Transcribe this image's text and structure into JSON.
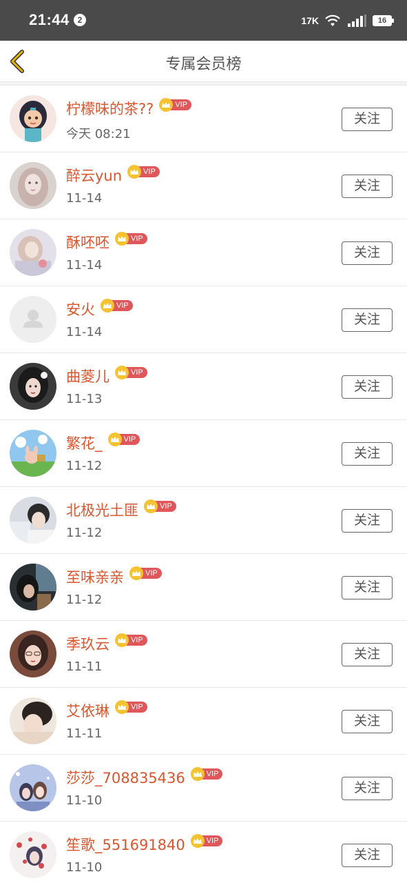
{
  "status_bar": {
    "time": "21:44",
    "notification_count": "2",
    "net_speed": "17K",
    "battery": "16",
    "icons": [
      "wifi-icon",
      "signal-icon",
      "battery-icon"
    ]
  },
  "header": {
    "title": "专属会员榜",
    "back_icon": "chevron-left-icon"
  },
  "members": [
    {
      "name": "柠檬味的茶??",
      "date": "今天 08:21",
      "vip": "VIP",
      "follow": "关注"
    },
    {
      "name": "醉云yun",
      "date": "11-14",
      "vip": "VIP",
      "follow": "关注"
    },
    {
      "name": "酥呸呸",
      "date": "11-14",
      "vip": "VIP",
      "follow": "关注"
    },
    {
      "name": "安火",
      "date": "11-14",
      "vip": "VIP",
      "follow": "关注"
    },
    {
      "name": "曲菱儿",
      "date": "11-13",
      "vip": "VIP",
      "follow": "关注"
    },
    {
      "name": "繁花_",
      "date": "11-12",
      "vip": "VIP",
      "follow": "关注"
    },
    {
      "name": "北极光土匪",
      "date": "11-12",
      "vip": "VIP",
      "follow": "关注"
    },
    {
      "name": "至味亲亲",
      "date": "11-12",
      "vip": "VIP",
      "follow": "关注"
    },
    {
      "name": "季玖云",
      "date": "11-11",
      "vip": "VIP",
      "follow": "关注"
    },
    {
      "name": "艾依琳",
      "date": "11-11",
      "vip": "VIP",
      "follow": "关注"
    },
    {
      "name": "莎莎_708835436",
      "date": "11-10",
      "vip": "VIP",
      "follow": "关注"
    },
    {
      "name": "笙歌_551691840",
      "date": "11-10",
      "vip": "VIP",
      "follow": "关注"
    }
  ],
  "colors": {
    "name": "#d9572f",
    "vip_badge": "#e0575b",
    "crown": "#f5c232",
    "back_arrow": "#e6b400",
    "status_bar": "#4a4a4a"
  }
}
